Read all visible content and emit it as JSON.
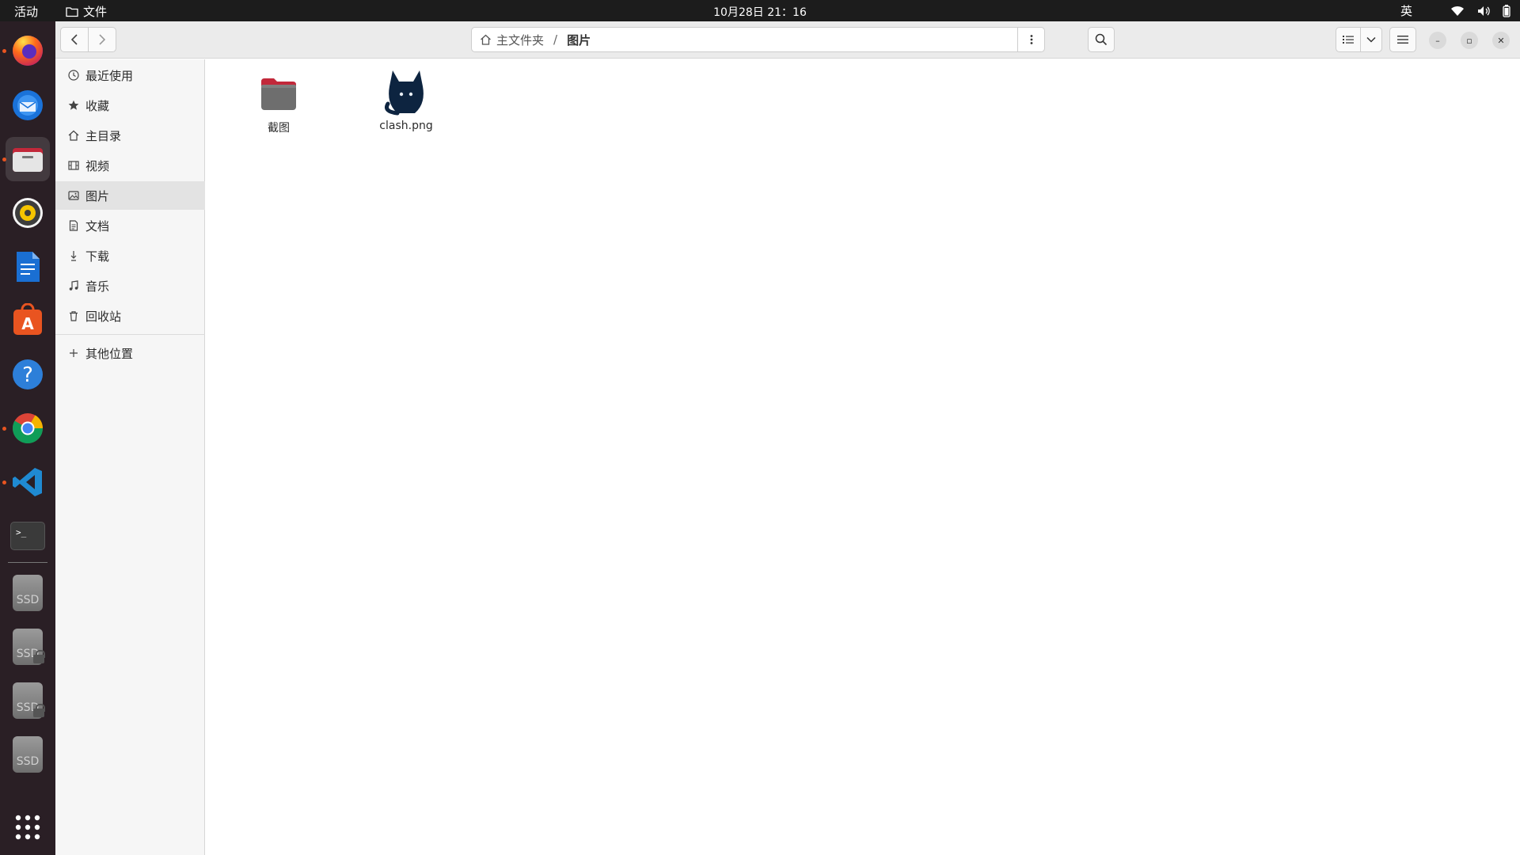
{
  "topbar": {
    "activities": "活动",
    "app_name": "文件",
    "clock": "10月28日  21：16",
    "ime": "英"
  },
  "dock": {
    "items": [
      {
        "name": "firefox",
        "running": true
      },
      {
        "name": "thunderbird",
        "running": false
      },
      {
        "name": "files",
        "running": true,
        "active": true
      },
      {
        "name": "rhythmbox",
        "running": false
      },
      {
        "name": "libreoffice-writer",
        "running": false
      },
      {
        "name": "app-center",
        "running": false
      },
      {
        "name": "help",
        "running": false
      },
      {
        "name": "chrome",
        "running": true
      },
      {
        "name": "vscode",
        "running": true
      },
      {
        "name": "terminal",
        "running": false
      }
    ],
    "drives": [
      {
        "label": "SSD",
        "locked": false
      },
      {
        "label": "SSD",
        "locked": true
      },
      {
        "label": "SSD",
        "locked": true
      },
      {
        "label": "SSD",
        "locked": false
      }
    ],
    "terminal_prompt": ">_"
  },
  "headerbar": {
    "path_home": "主文件夹",
    "path_separator": "/",
    "path_current": "图片",
    "window_controls": {
      "minimize": "–",
      "maximize": "▫",
      "close": "✕"
    }
  },
  "sidebar": {
    "items": [
      {
        "label": "最近使用",
        "icon": "clock-icon"
      },
      {
        "label": "收藏",
        "icon": "star-icon"
      },
      {
        "label": "主目录",
        "icon": "home-icon"
      },
      {
        "label": "视频",
        "icon": "film-icon"
      },
      {
        "label": "图片",
        "icon": "image-icon",
        "selected": true
      },
      {
        "label": "文档",
        "icon": "document-icon"
      },
      {
        "label": "下载",
        "icon": "download-icon"
      },
      {
        "label": "音乐",
        "icon": "music-icon"
      },
      {
        "label": "回收站",
        "icon": "trash-icon"
      }
    ],
    "other_locations": "其他位置"
  },
  "files": [
    {
      "name": "截图",
      "type": "folder"
    },
    {
      "name": "clash.png",
      "type": "image"
    }
  ],
  "colors": {
    "accent": "#e95420",
    "dock_bg": "#2a1f25",
    "topbar_bg": "#1c1c1c",
    "selected_bg": "#e3e3e3"
  }
}
